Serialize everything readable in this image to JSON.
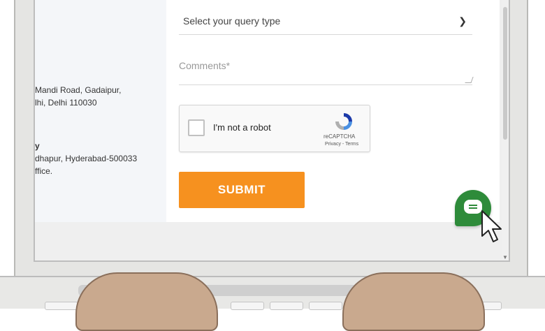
{
  "form": {
    "query_select_value": "Select your query type",
    "comments_placeholder": "Comments*",
    "recaptcha_label": "I'm not a robot",
    "recaptcha_brand": "reCAPTCHA",
    "recaptcha_terms": "Privacy - Terms",
    "submit_label": "SUBMIT"
  },
  "addresses": {
    "line1": "Mandi Road, Gadaipur,",
    "line2": "lhi, Delhi 110030",
    "heading2": "y",
    "line3": "dhapur, Hyderabad-500033",
    "line4": "ffice."
  },
  "colors": {
    "submit": "#f6911f",
    "chat": "#2e8b3a"
  },
  "icons": {
    "chevron": "chevron-down-icon",
    "chat": "chat-icon",
    "cursor": "mouse-pointer-icon",
    "recaptcha": "recaptcha-logo-icon"
  }
}
